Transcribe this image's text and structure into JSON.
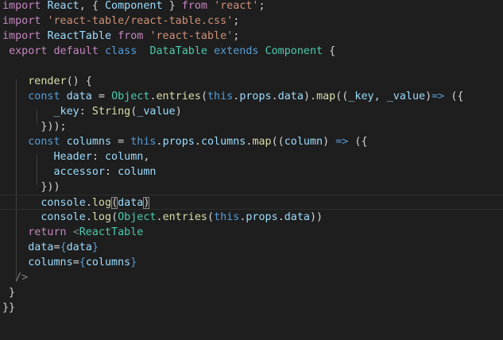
{
  "editor": {
    "language": "javascript",
    "current_line_index": 13,
    "lines": [
      [
        [
          "kw",
          "import"
        ],
        [
          "pun",
          " "
        ],
        [
          "var",
          "React"
        ],
        [
          "pun",
          ", { "
        ],
        [
          "var",
          "Component"
        ],
        [
          "pun",
          " } "
        ],
        [
          "kw",
          "from"
        ],
        [
          "pun",
          " "
        ],
        [
          "str",
          "'react'"
        ],
        [
          "pun",
          ";"
        ]
      ],
      [
        [
          "kw",
          "import"
        ],
        [
          "pun",
          " "
        ],
        [
          "str",
          "'react-table/react-table.css'"
        ],
        [
          "pun",
          ";"
        ]
      ],
      [
        [
          "kw",
          "import"
        ],
        [
          "pun",
          " "
        ],
        [
          "var",
          "ReactTable"
        ],
        [
          "pun",
          " "
        ],
        [
          "kw",
          "from"
        ],
        [
          "pun",
          " "
        ],
        [
          "str",
          "'react-table'"
        ],
        [
          "pun",
          ";"
        ]
      ],
      [
        [
          "pun",
          " "
        ],
        [
          "kw",
          "export"
        ],
        [
          "pun",
          " "
        ],
        [
          "kw",
          "default"
        ],
        [
          "pun",
          " "
        ],
        [
          "kwb",
          "class"
        ],
        [
          "pun",
          "  "
        ],
        [
          "cls",
          "DataTable"
        ],
        [
          "pun",
          " "
        ],
        [
          "kwb",
          "extends"
        ],
        [
          "pun",
          " "
        ],
        [
          "cls",
          "Component"
        ],
        [
          "pun",
          " {"
        ]
      ],
      [],
      [
        [
          "pun",
          "    "
        ],
        [
          "fn",
          "render"
        ],
        [
          "pun",
          "() {"
        ]
      ],
      [
        [
          "pun",
          "    "
        ],
        [
          "kwb",
          "const"
        ],
        [
          "pun",
          " "
        ],
        [
          "var",
          "data"
        ],
        [
          "pun",
          " = "
        ],
        [
          "cls",
          "Object"
        ],
        [
          "pun",
          "."
        ],
        [
          "fn",
          "entries"
        ],
        [
          "pun",
          "("
        ],
        [
          "kwb",
          "this"
        ],
        [
          "pun",
          "."
        ],
        [
          "var",
          "props"
        ],
        [
          "pun",
          "."
        ],
        [
          "var",
          "data"
        ],
        [
          "pun",
          ")."
        ],
        [
          "fn",
          "map"
        ],
        [
          "pun",
          "(("
        ],
        [
          "var",
          "_key"
        ],
        [
          "pun",
          ", "
        ],
        [
          "var",
          "_value"
        ],
        [
          "pun",
          ")"
        ],
        [
          "kwb",
          "=>"
        ],
        [
          "pun",
          " ({"
        ]
      ],
      [
        [
          "pun",
          "        "
        ],
        [
          "var",
          "_key"
        ],
        [
          "pun",
          ": "
        ],
        [
          "fn",
          "String"
        ],
        [
          "pun",
          "("
        ],
        [
          "var",
          "_value"
        ],
        [
          "pun",
          ")"
        ]
      ],
      [
        [
          "pun",
          "      }));"
        ]
      ],
      [
        [
          "pun",
          "    "
        ],
        [
          "kwb",
          "const"
        ],
        [
          "pun",
          " "
        ],
        [
          "var",
          "columns"
        ],
        [
          "pun",
          " = "
        ],
        [
          "kwb",
          "this"
        ],
        [
          "pun",
          "."
        ],
        [
          "var",
          "props"
        ],
        [
          "pun",
          "."
        ],
        [
          "var",
          "columns"
        ],
        [
          "pun",
          "."
        ],
        [
          "fn",
          "map"
        ],
        [
          "pun",
          "(("
        ],
        [
          "var",
          "column"
        ],
        [
          "pun",
          ") "
        ],
        [
          "kwb",
          "=>"
        ],
        [
          "pun",
          " ({"
        ]
      ],
      [
        [
          "pun",
          "        "
        ],
        [
          "var",
          "Header"
        ],
        [
          "pun",
          ": "
        ],
        [
          "var",
          "column"
        ],
        [
          "pun",
          ","
        ]
      ],
      [
        [
          "pun",
          "        "
        ],
        [
          "var",
          "accessor"
        ],
        [
          "pun",
          ": "
        ],
        [
          "var",
          "column"
        ]
      ],
      [
        [
          "pun",
          "      }))"
        ]
      ],
      [
        [
          "pun",
          "      "
        ],
        [
          "var",
          "console"
        ],
        [
          "pun",
          "."
        ],
        [
          "fn",
          "log"
        ],
        [
          "brk",
          "("
        ],
        [
          "var",
          "data"
        ],
        [
          "brk",
          ")"
        ]
      ],
      [
        [
          "pun",
          "      "
        ],
        [
          "var",
          "console"
        ],
        [
          "pun",
          "."
        ],
        [
          "fn",
          "log"
        ],
        [
          "pun",
          "("
        ],
        [
          "cls",
          "Object"
        ],
        [
          "pun",
          "."
        ],
        [
          "fn",
          "entries"
        ],
        [
          "pun",
          "("
        ],
        [
          "kwb",
          "this"
        ],
        [
          "pun",
          "."
        ],
        [
          "var",
          "props"
        ],
        [
          "pun",
          "."
        ],
        [
          "var",
          "data"
        ],
        [
          "pun",
          "))"
        ]
      ],
      [
        [
          "pun",
          "    "
        ],
        [
          "kw",
          "return"
        ],
        [
          "pun",
          " "
        ],
        [
          "tag",
          "<"
        ],
        [
          "cls",
          "ReactTable"
        ]
      ],
      [
        [
          "pun",
          "    "
        ],
        [
          "var",
          "data"
        ],
        [
          "pun",
          "="
        ],
        [
          "kwb",
          "{"
        ],
        [
          "var",
          "data"
        ],
        [
          "kwb",
          "}"
        ]
      ],
      [
        [
          "pun",
          "    "
        ],
        [
          "var",
          "columns"
        ],
        [
          "pun",
          "="
        ],
        [
          "kwb",
          "{"
        ],
        [
          "var",
          "columns"
        ],
        [
          "kwb",
          "}"
        ]
      ],
      [
        [
          "pun",
          "  "
        ],
        [
          "tag",
          "/>"
        ]
      ],
      [
        [
          "pun",
          " }"
        ]
      ],
      [
        [
          "pun",
          "}}"
        ]
      ]
    ]
  }
}
